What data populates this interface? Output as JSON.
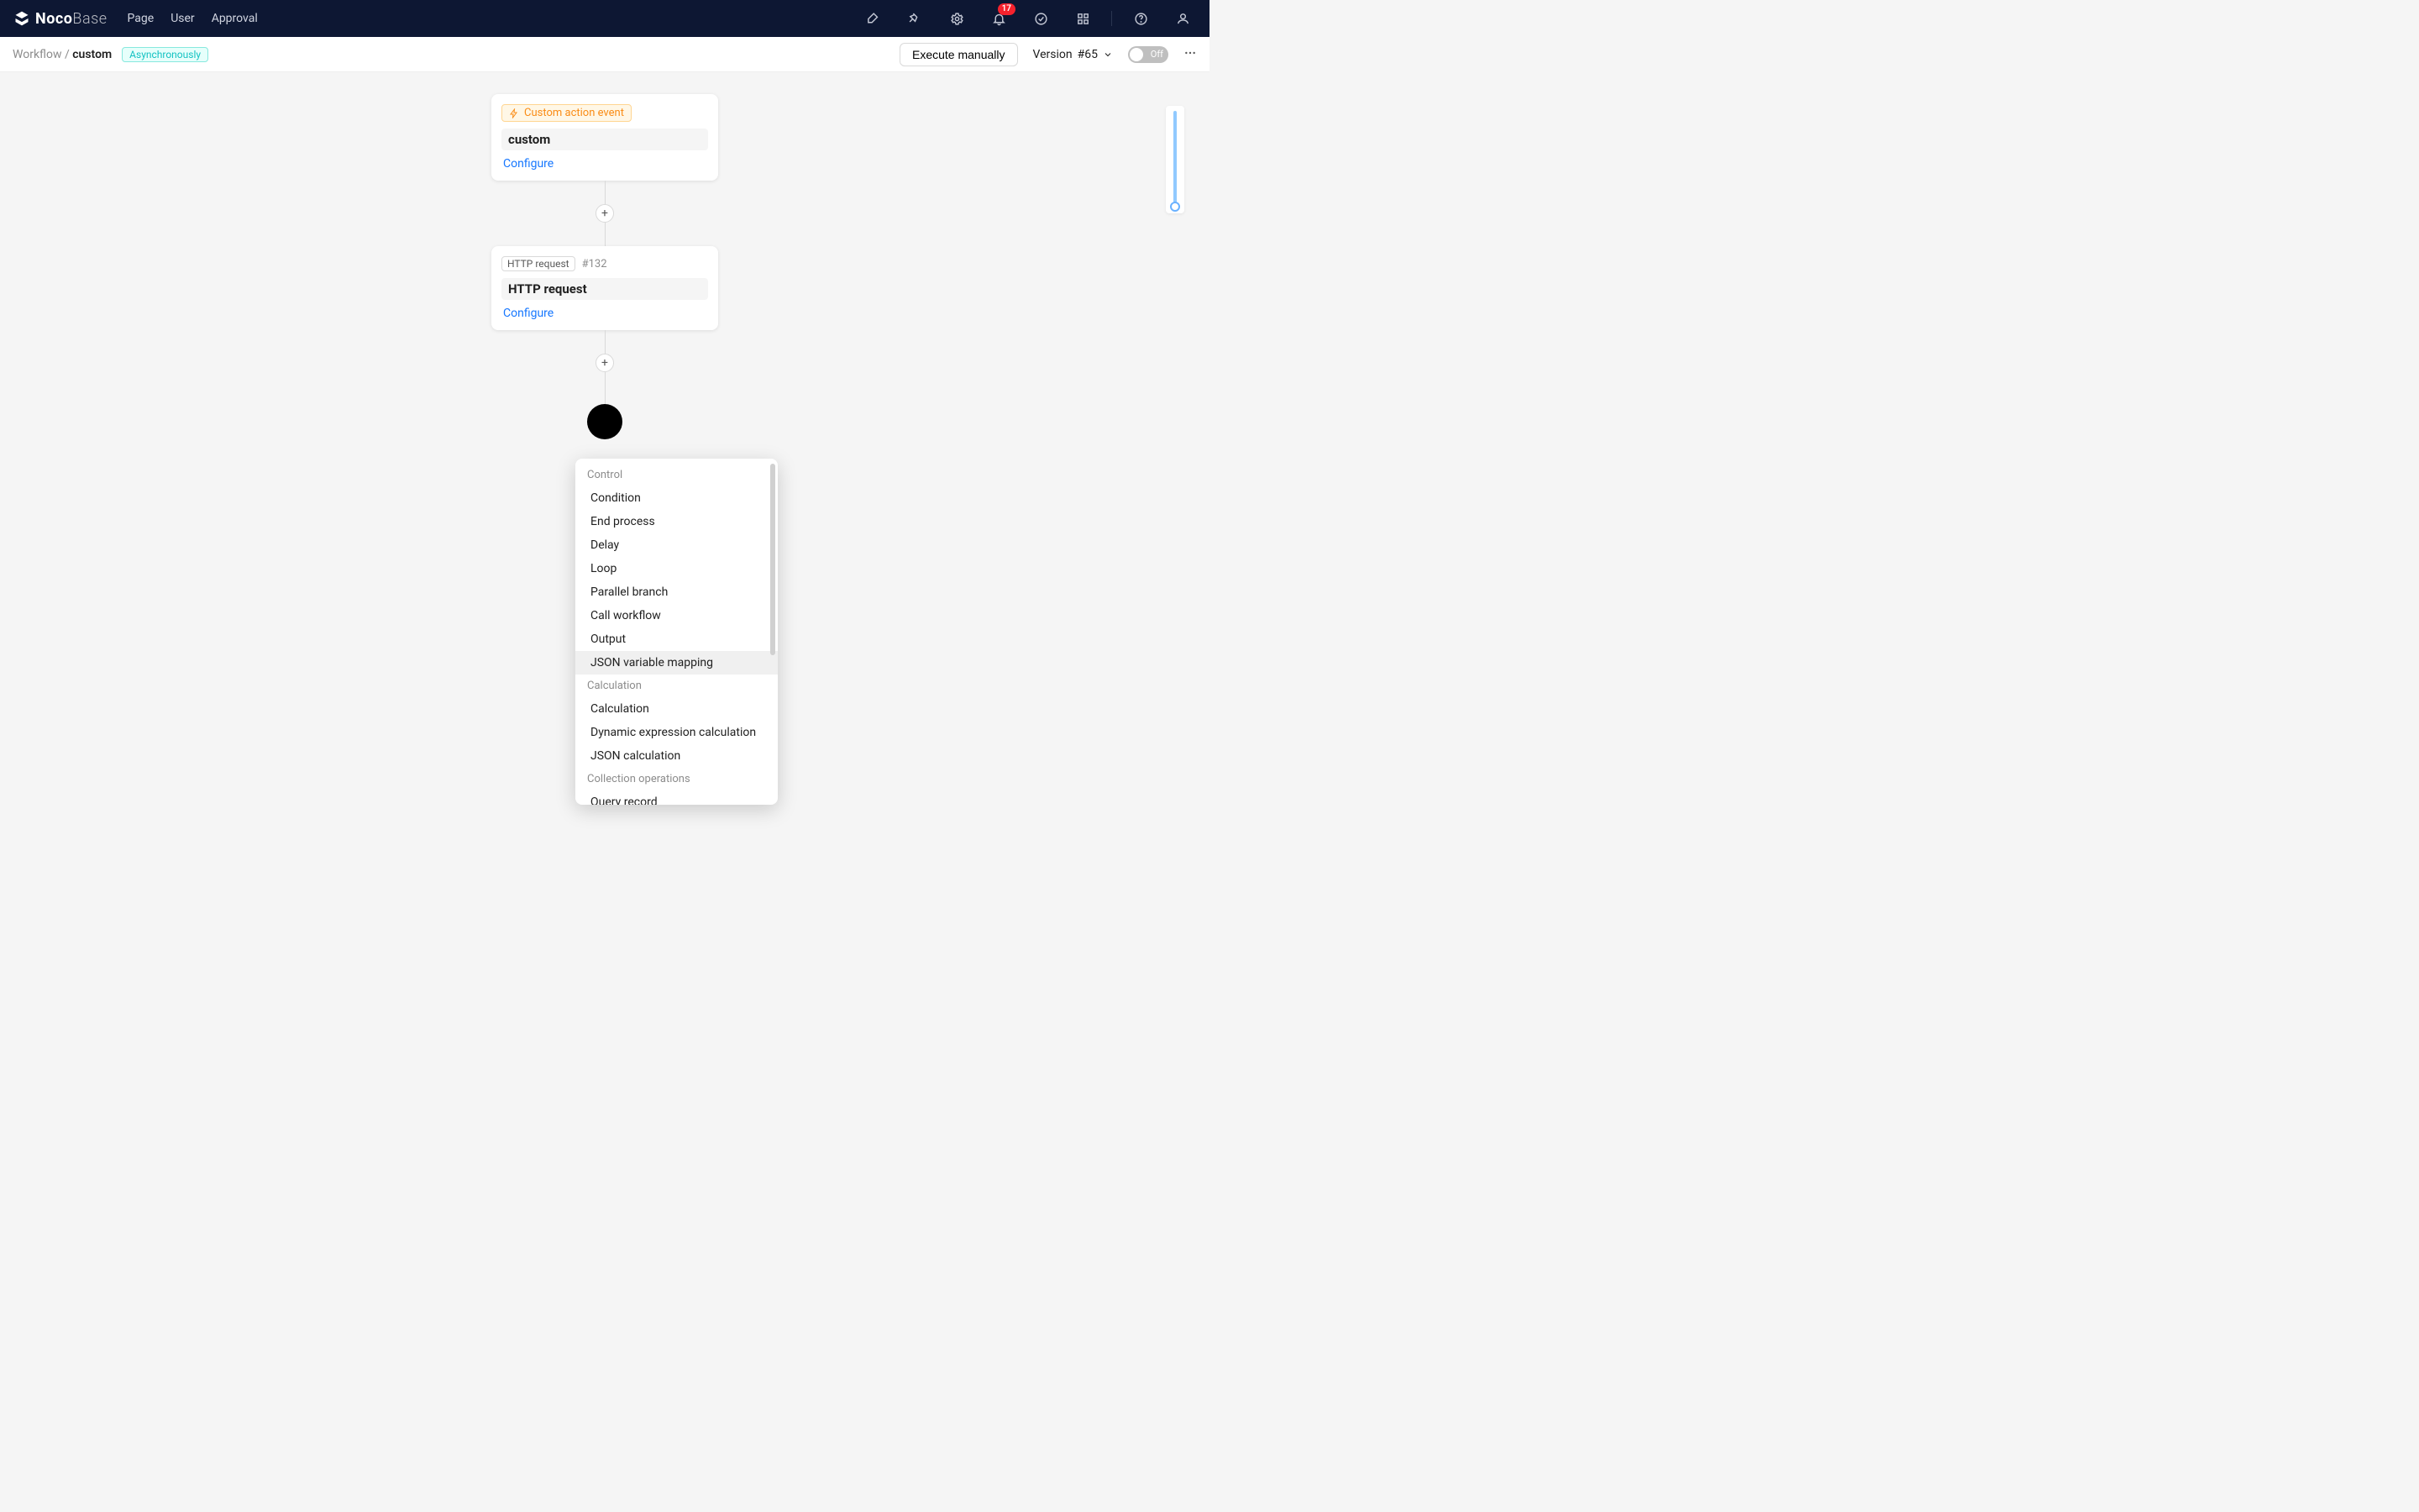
{
  "nav": {
    "logo_bold": "Noco",
    "logo_light": "Base",
    "items": [
      "Page",
      "User",
      "Approval"
    ],
    "badge_count": "17"
  },
  "secbar": {
    "breadcrumb_root": "Workflow",
    "breadcrumb_sep": " / ",
    "breadcrumb_current": "custom",
    "execution_mode_tag": "Asynchronously",
    "execute_btn": "Execute manually",
    "version_label": "Version",
    "version_value": "#65",
    "toggle_label": "Off"
  },
  "flow": {
    "trigger": {
      "tag": "Custom action event",
      "name": "custom",
      "link": "Configure"
    },
    "node1": {
      "type_badge": "HTTP request",
      "id": "#132",
      "name": "HTTP request",
      "link": "Configure"
    }
  },
  "dropdown": {
    "groups": [
      {
        "label": "Control",
        "items": [
          "Condition",
          "End process",
          "Delay",
          "Loop",
          "Parallel branch",
          "Call workflow",
          "Output",
          "JSON variable mapping"
        ],
        "hover_index": 7
      },
      {
        "label": "Calculation",
        "items": [
          "Calculation",
          "Dynamic expression calculation",
          "JSON calculation"
        ]
      },
      {
        "label": "Collection operations",
        "items": [
          "Query record"
        ]
      }
    ]
  }
}
